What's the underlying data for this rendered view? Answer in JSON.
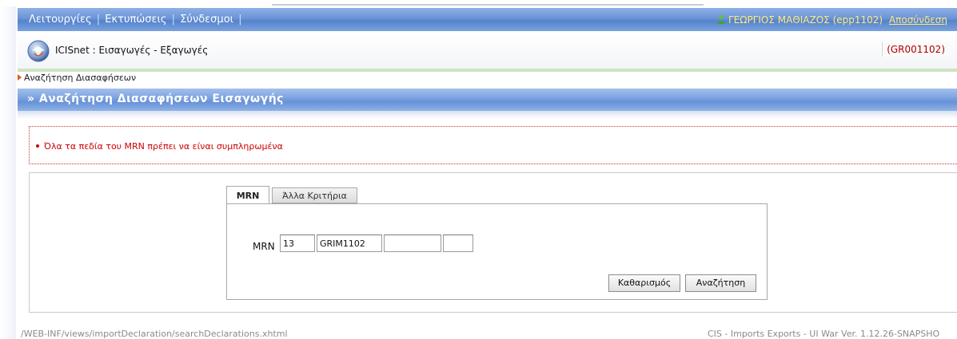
{
  "menu": {
    "items": [
      "Λειτουργίες",
      "Εκτυπώσεις",
      "Σύνδεσμοι"
    ],
    "separator": "|",
    "user": "ΓΕΩΡΓΙΟΣ ΜΑΘΙΑΖΟΣ (epp1102)",
    "logout": "Αποσύνδεση"
  },
  "app": {
    "title": "ICISnet : Εισαγωγές - Εξαγωγές",
    "code": "(GR001102)"
  },
  "breadcrumb": "Αναζήτηση Διασαφήσεων",
  "section": {
    "title": "» Αναζήτηση Διασαφήσεων Εισαγωγής"
  },
  "error": {
    "message": "Όλα τα πεδία του MRN πρέπει να είναι συμπληρωμένα"
  },
  "tabs": [
    {
      "label": "MRN",
      "active": true
    },
    {
      "label": "Άλλα Κριτήρια",
      "active": false
    }
  ],
  "form": {
    "mrn_label": "MRN",
    "mrn_fields": [
      "13",
      "GRIM1102",
      "",
      ""
    ]
  },
  "buttons": {
    "clear": "Καθαρισμός",
    "search": "Αναζήτηση"
  },
  "footer": {
    "left": "/WEB-INF/views/importDeclaration/searchDeclarations.xhtml",
    "right": "CIS - Imports Exports - UI War Ver. 1.12.26-SNAPSHO"
  },
  "colors": {
    "menu_bar": "#6b94d6",
    "error": "#cc0000",
    "accent_orange": "#e05a1c"
  }
}
